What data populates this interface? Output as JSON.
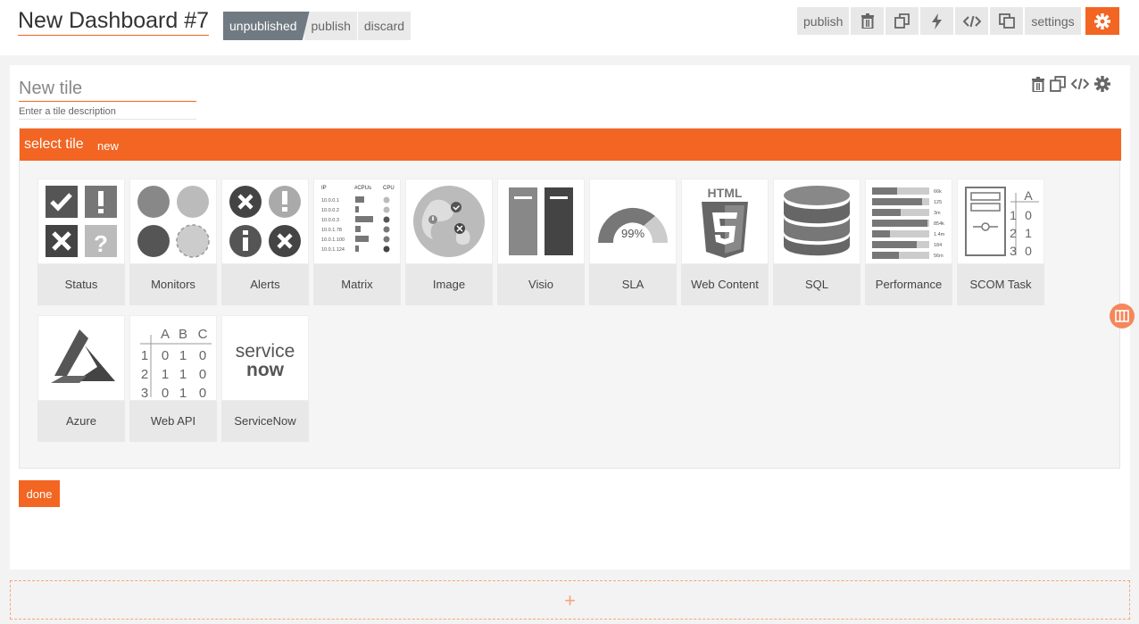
{
  "header": {
    "title": "New Dashboard #7",
    "status": "unpublished",
    "publish_label": "publish",
    "discard_label": "discard"
  },
  "toolbar": {
    "publish_label": "publish",
    "settings_label": "settings",
    "icons": [
      "trash-icon",
      "copy-icon",
      "bolt-icon",
      "code-icon",
      "clone-icon",
      "gear-icon"
    ]
  },
  "tile": {
    "title_placeholder": "New tile",
    "description_placeholder": "Enter a tile description",
    "tools": [
      "trash-icon",
      "copy-icon",
      "code-icon",
      "gear-icon"
    ]
  },
  "select": {
    "heading": "select tile",
    "badge": "new",
    "tiles": [
      {
        "label": "Status",
        "icon": "status-icon"
      },
      {
        "label": "Monitors",
        "icon": "monitors-icon"
      },
      {
        "label": "Alerts",
        "icon": "alerts-icon"
      },
      {
        "label": "Matrix",
        "icon": "matrix-icon"
      },
      {
        "label": "Image",
        "icon": "image-icon"
      },
      {
        "label": "Visio",
        "icon": "visio-icon"
      },
      {
        "label": "SLA",
        "icon": "sla-icon"
      },
      {
        "label": "Web Content",
        "icon": "html5-icon"
      },
      {
        "label": "SQL",
        "icon": "database-icon"
      },
      {
        "label": "Performance",
        "icon": "performance-icon"
      },
      {
        "label": "SCOM Task",
        "icon": "scom-task-icon"
      },
      {
        "label": "Azure",
        "icon": "azure-icon"
      },
      {
        "label": "Web API",
        "icon": "web-api-icon"
      },
      {
        "label": "ServiceNow",
        "icon": "servicenow-icon"
      }
    ],
    "sla_value": "99%",
    "html_text": "HTML",
    "servicenow_logo": "servicenow",
    "matrix_headers": [
      "IP",
      "#CPUs",
      "CPU"
    ],
    "matrix_ips": [
      "10.0.0.1",
      "10.0.0.2",
      "10.0.0.3",
      "10.0.1.78",
      "10.0.1.100",
      "10.0.1.124"
    ],
    "perf_values": [
      "66k",
      "125",
      "3m",
      "854k",
      "1.4m",
      "184",
      "56m"
    ],
    "webapi_headers": [
      "A",
      "B",
      "C"
    ],
    "webapi_rows": [
      [
        "1",
        "0",
        "1",
        "0"
      ],
      [
        "2",
        "1",
        "1",
        "0"
      ],
      [
        "3",
        "0",
        "1",
        "0"
      ]
    ],
    "scom_rows": [
      [
        "A",
        ""
      ],
      [
        "1",
        "0"
      ],
      [
        "2",
        "1"
      ],
      [
        "3",
        "0"
      ]
    ]
  },
  "actions": {
    "done_label": "done",
    "add_label": "+"
  },
  "colors": {
    "accent": "#f26522",
    "status_gray": "#707a82",
    "icon_dark": "#444444",
    "icon_light": "#bbbbbb"
  }
}
